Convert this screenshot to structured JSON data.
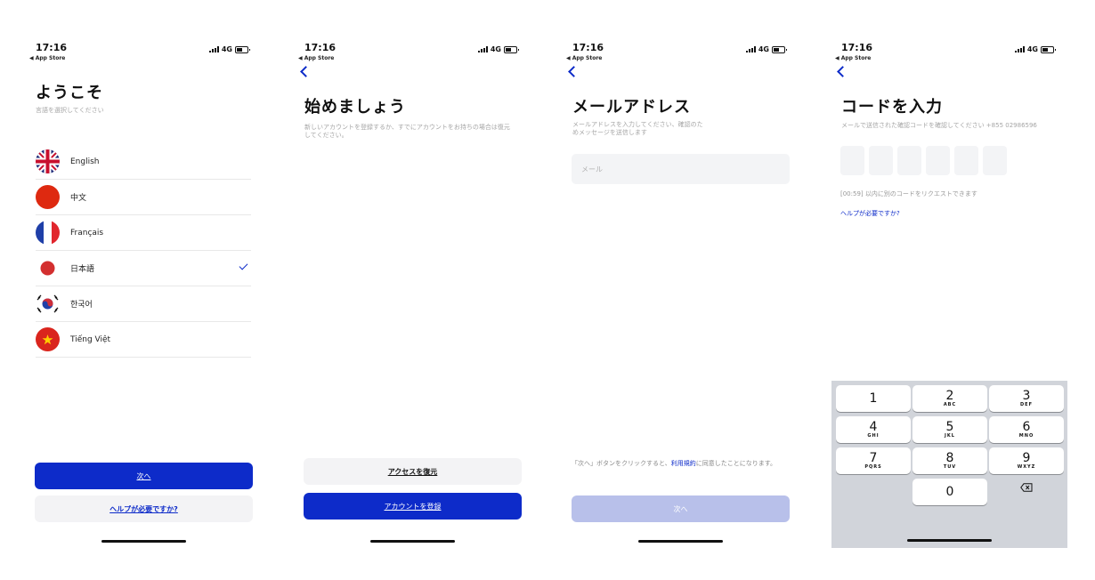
{
  "status": {
    "time": "17:16",
    "back_app": "◀ App Store",
    "network": "4G"
  },
  "screen1": {
    "title": "ようこそ",
    "subtitle": "言語を選択してください",
    "languages": [
      {
        "label": "English",
        "flag": "uk-flag-icon"
      },
      {
        "label": "中文",
        "flag": "china-flag-icon"
      },
      {
        "label": "Français",
        "flag": "france-flag-icon"
      },
      {
        "label": "日本語",
        "flag": "japan-flag-icon",
        "selected": true
      },
      {
        "label": "한국어",
        "flag": "korea-flag-icon"
      },
      {
        "label": "Tiếng Việt",
        "flag": "vietnam-flag-icon"
      }
    ],
    "next_label": "次へ",
    "help_label": "ヘルプが必要ですか?"
  },
  "screen2": {
    "title": "始めましょう",
    "subtitle": "新しいアカウントを登録するか、すでにアカウントをお持ちの場合は復元してください。",
    "restore_label": "アクセスを復元",
    "register_label": "アカウントを登録"
  },
  "screen3": {
    "title": "メールアドレス",
    "subtitle": "メールアドレスを入力してください、確認のためメッセージを送信します",
    "email_placeholder": "メール",
    "terms_prefix": "「次へ」ボタンをクリックすると、",
    "terms_link": "利用規約",
    "terms_suffix": "に同意したことになります。",
    "next_label": "次へ"
  },
  "screen4": {
    "title": "コードを入力",
    "subtitle": "メールで送信された確認コードを確認してください +855 02986596",
    "countdown": "[00:59] 以内に別のコードをリクエストできます",
    "help_label": "ヘルプが必要ですか?",
    "keypad": [
      {
        "num": "1",
        "letters": ""
      },
      {
        "num": "2",
        "letters": "ABC"
      },
      {
        "num": "3",
        "letters": "DEF"
      },
      {
        "num": "4",
        "letters": "GHI"
      },
      {
        "num": "5",
        "letters": "JKL"
      },
      {
        "num": "6",
        "letters": "MNO"
      },
      {
        "num": "7",
        "letters": "PQRS"
      },
      {
        "num": "8",
        "letters": "TUV"
      },
      {
        "num": "9",
        "letters": "WXYZ"
      },
      {
        "num": "0",
        "letters": ""
      }
    ]
  },
  "colors": {
    "accent": "#0d2bc9",
    "disabled": "#b8c0ea",
    "field": "#f3f4f6"
  }
}
